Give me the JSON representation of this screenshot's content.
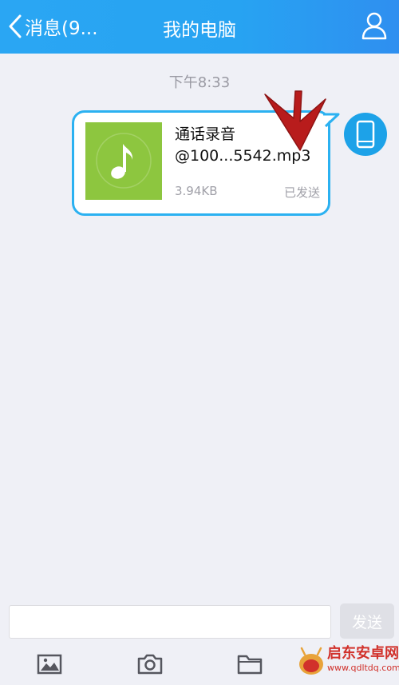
{
  "header": {
    "back_label": "消息(9...",
    "title": "我的电脑"
  },
  "chat": {
    "timestamp": "下午8:33",
    "message": {
      "file_name_line1": "通话录音",
      "file_name_line2": "@100...5542.mp3",
      "file_size": "3.94KB",
      "status": "已发送"
    }
  },
  "composer": {
    "input_value": "",
    "send_label": "发送"
  },
  "toolbar": {
    "icons": [
      "image-icon",
      "camera-icon",
      "folder-icon"
    ]
  },
  "watermark": {
    "name": "启东安卓网",
    "url": "www.qdltdq.com"
  },
  "colors": {
    "nav": "#27a3f2",
    "accent_border": "#2bb1f1",
    "file_thumb": "#8dc63f",
    "annotation_arrow": "#b81c1c"
  }
}
